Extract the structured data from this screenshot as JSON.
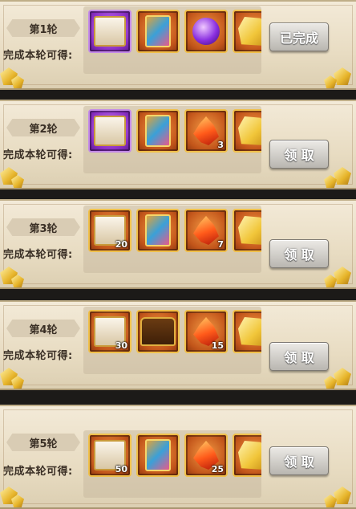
{
  "rounds": [
    {
      "title": "第1轮",
      "reward_label": "完成本轮可得:",
      "button": "已完成",
      "rewards": [
        {
          "icon": "silver-chest-icon",
          "frame": "purple",
          "count": ""
        },
        {
          "icon": "hero-card-icon",
          "frame": "orange",
          "count": ""
        },
        {
          "icon": "purple-orb-icon",
          "frame": "orange",
          "count": ""
        },
        {
          "icon": "gold-crystal-icon",
          "frame": "orange",
          "count": ""
        }
      ]
    },
    {
      "title": "第2轮",
      "reward_label": "完成本轮可得:",
      "button": "领 取",
      "rewards": [
        {
          "icon": "silver-chest-icon",
          "frame": "purple",
          "count": ""
        },
        {
          "icon": "hero-card-icon",
          "frame": "orange",
          "count": ""
        },
        {
          "icon": "phoenix-feather-icon",
          "frame": "orange",
          "count": "3"
        },
        {
          "icon": "gold-crystal-icon",
          "frame": "orange",
          "count": ""
        }
      ]
    },
    {
      "title": "第3轮",
      "reward_label": "完成本轮可得:",
      "button": "领 取",
      "rewards": [
        {
          "icon": "gold-chest-icon",
          "frame": "orange",
          "count": "20"
        },
        {
          "icon": "hero-card-icon",
          "frame": "orange",
          "count": ""
        },
        {
          "icon": "phoenix-feather-icon",
          "frame": "orange",
          "count": "7"
        },
        {
          "icon": "gold-crystal-icon",
          "frame": "orange",
          "count": ""
        }
      ]
    },
    {
      "title": "第4轮",
      "reward_label": "完成本轮可得:",
      "button": "领 取",
      "rewards": [
        {
          "icon": "gold-chest-icon",
          "frame": "orange",
          "count": "30"
        },
        {
          "icon": "treasure-chest-icon",
          "frame": "orange",
          "count": ""
        },
        {
          "icon": "phoenix-feather-icon",
          "frame": "orange",
          "count": "15"
        },
        {
          "icon": "gold-crystal-icon",
          "frame": "orange",
          "count": ""
        }
      ]
    },
    {
      "title": "第5轮",
      "reward_label": "完成本轮可得:",
      "button": "领 取",
      "rewards": [
        {
          "icon": "gold-chest-icon",
          "frame": "orange",
          "count": "50"
        },
        {
          "icon": "hero-card-icon",
          "frame": "orange",
          "count": ""
        },
        {
          "icon": "phoenix-feather-icon",
          "frame": "orange",
          "count": "25"
        },
        {
          "icon": "gold-crystal-icon",
          "frame": "orange",
          "count": ""
        }
      ]
    }
  ]
}
